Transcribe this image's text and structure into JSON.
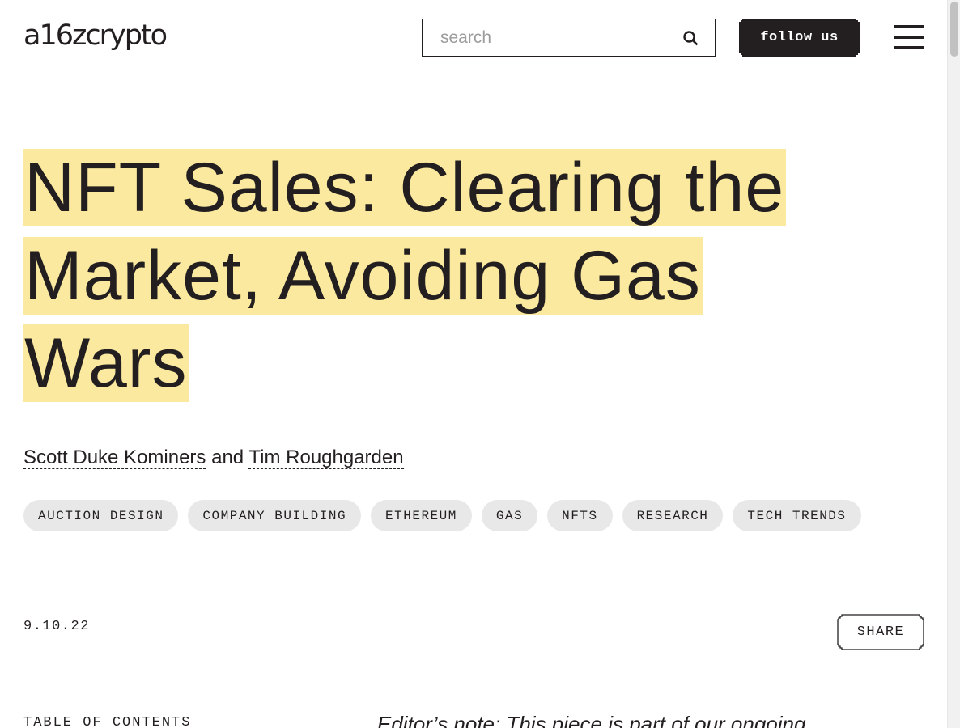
{
  "header": {
    "logo": "a16zcrypto",
    "search_placeholder": "search",
    "follow_label": "follow us"
  },
  "article": {
    "title": "NFT Sales: Clearing the Market, Avoiding Gas Wars",
    "authors": {
      "first": "Scott Duke Kominers",
      "conjunction": "and",
      "second": "Tim Roughgarden"
    },
    "tags": [
      "AUCTION DESIGN",
      "COMPANY BUILDING",
      "ETHEREUM",
      "GAS",
      "NFTS",
      "RESEARCH",
      "TECH TRENDS"
    ],
    "date": "9.10.22",
    "share_label": "SHARE",
    "toc_heading": "TABLE OF CONTENTS",
    "editor_note": "Editor’s note: This piece is part of our ongoing"
  },
  "colors": {
    "text": "#231f20",
    "highlight": "#fae99e",
    "tag_bg": "#e8e8e8"
  }
}
